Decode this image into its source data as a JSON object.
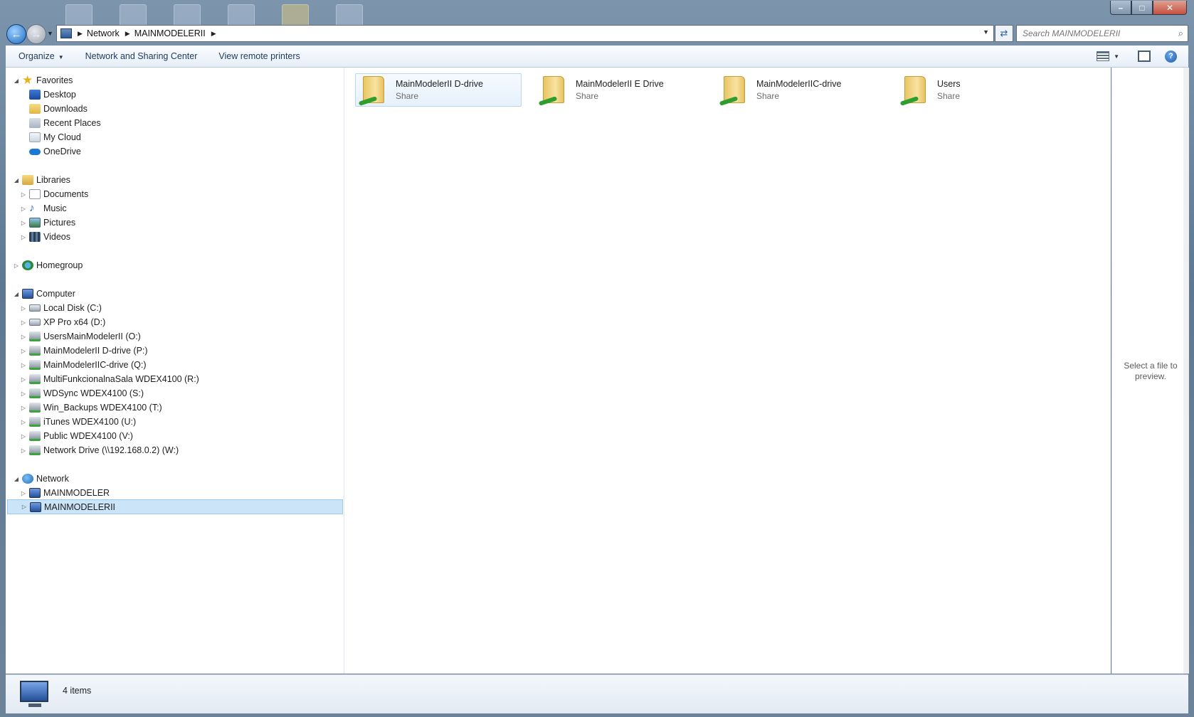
{
  "address": {
    "crumbs": [
      "Network",
      "MAINMODELERII"
    ]
  },
  "search": {
    "placeholder": "Search MAINMODELERII"
  },
  "toolbar": {
    "organize": "Organize",
    "network_sharing": "Network and Sharing Center",
    "remote_printers": "View remote printers"
  },
  "nav": {
    "favorites": "Favorites",
    "favorites_items": [
      "Desktop",
      "Downloads",
      "Recent Places",
      "My Cloud",
      "OneDrive"
    ],
    "libraries": "Libraries",
    "libraries_items": [
      "Documents",
      "Music",
      "Pictures",
      "Videos"
    ],
    "homegroup": "Homegroup",
    "computer": "Computer",
    "computer_items": [
      "Local Disk (C:)",
      "XP Pro x64 (D:)",
      "UsersMainModelerII (O:)",
      "MainModelerII D-drive (P:)",
      "MainModelerIIC-drive (Q:)",
      "MultiFunkcionalnaSala WDEX4100 (R:)",
      "WDSync WDEX4100 (S:)",
      "Win_Backups WDEX4100 (T:)",
      "iTunes WDEX4100 (U:)",
      "Public WDEX4100 (V:)",
      "Network Drive (\\\\192.168.0.2) (W:)"
    ],
    "network": "Network",
    "network_items": [
      "MAINMODELER",
      "MAINMODELERII"
    ]
  },
  "shares": [
    {
      "name": "MainModelerII D-drive",
      "type": "Share"
    },
    {
      "name": "MainModelerII E Drive",
      "type": "Share"
    },
    {
      "name": "MainModelerIIC-drive",
      "type": "Share"
    },
    {
      "name": "Users",
      "type": "Share"
    }
  ],
  "preview": {
    "text": "Select a file to preview."
  },
  "status": {
    "count": "4 items"
  }
}
